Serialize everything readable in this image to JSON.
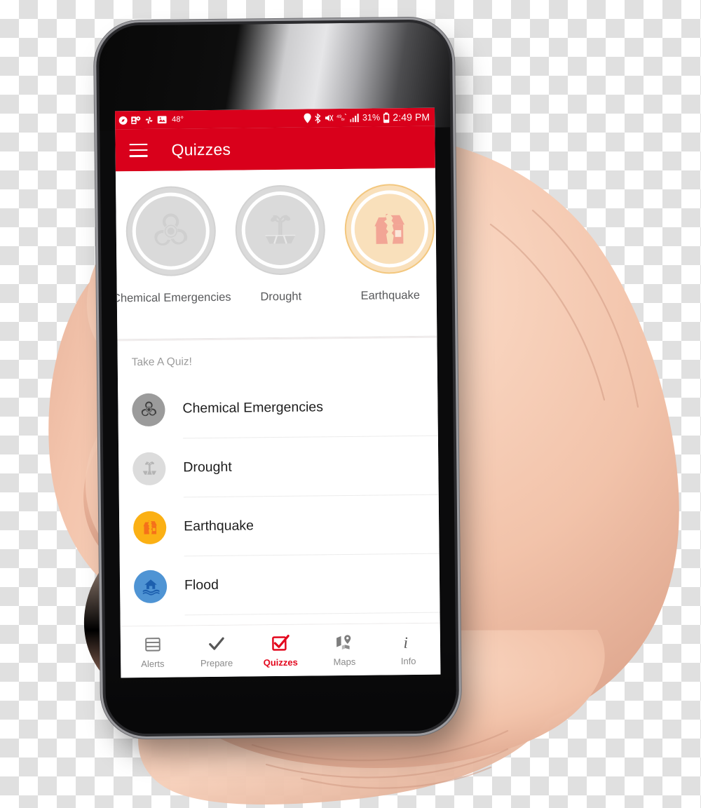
{
  "statusbar": {
    "left_icons": [
      "compass-icon",
      "contacts-sync-icon",
      "pinwheel-icon",
      "photo-icon"
    ],
    "temperature": "48°",
    "right_icons": [
      "location-pin-icon",
      "bluetooth-icon",
      "vibrate-mute-icon",
      "data-saver-icon",
      "signal-bars-icon"
    ],
    "battery_percent": "31%",
    "battery_icon": "battery-icon",
    "time": "2:49 PM"
  },
  "appbar": {
    "menu_icon": "hamburger-menu-icon",
    "title": "Quizzes",
    "background_color": "#d9001b"
  },
  "badges": [
    {
      "label": "Chemical Emergencies",
      "icon": "biohazard-icon",
      "state": "locked",
      "disc_color": "#dadada",
      "icon_color": "#cfcfcf"
    },
    {
      "label": "Drought",
      "icon": "wilting-plant-icon",
      "state": "locked",
      "disc_color": "#dadada",
      "icon_color": "#cfcfcf"
    },
    {
      "label": "Earthquake",
      "icon": "cracked-house-icon",
      "state": "earned",
      "disc_color": "#f9e0bb",
      "icon_color": "#f2a595"
    }
  ],
  "list": {
    "section_title": "Take A Quiz!",
    "items": [
      {
        "label": "Chemical Emergencies",
        "icon": "biohazard-icon",
        "circle_color": "#9b9b9b",
        "glyph_color": "#3f3f3f"
      },
      {
        "label": "Drought",
        "icon": "wilting-plant-icon",
        "circle_color": "#dcdcdc",
        "glyph_color": "#b4b4b4"
      },
      {
        "label": "Earthquake",
        "icon": "cracked-house-icon",
        "circle_color": "#fbb014",
        "glyph_color": "#f5711a"
      },
      {
        "label": "Flood",
        "icon": "flood-house-icon",
        "circle_color": "#4f94d4",
        "glyph_color": "#1c5fae"
      },
      {
        "label": "",
        "icon": "sun-heat-icon",
        "circle_color": "#f7df1e",
        "glyph_color": "#e8a400"
      }
    ]
  },
  "bottomnav": {
    "active_color": "#e3071d",
    "items": [
      {
        "label": "Alerts",
        "icon": "list-alerts-icon",
        "active": false
      },
      {
        "label": "Prepare",
        "icon": "checkmark-icon",
        "active": false
      },
      {
        "label": "Quizzes",
        "icon": "checkbox-checked-icon",
        "active": true
      },
      {
        "label": "Maps",
        "icon": "map-pin-icon",
        "active": false
      },
      {
        "label": "Info",
        "icon": "info-italic-icon",
        "active": false
      }
    ]
  }
}
